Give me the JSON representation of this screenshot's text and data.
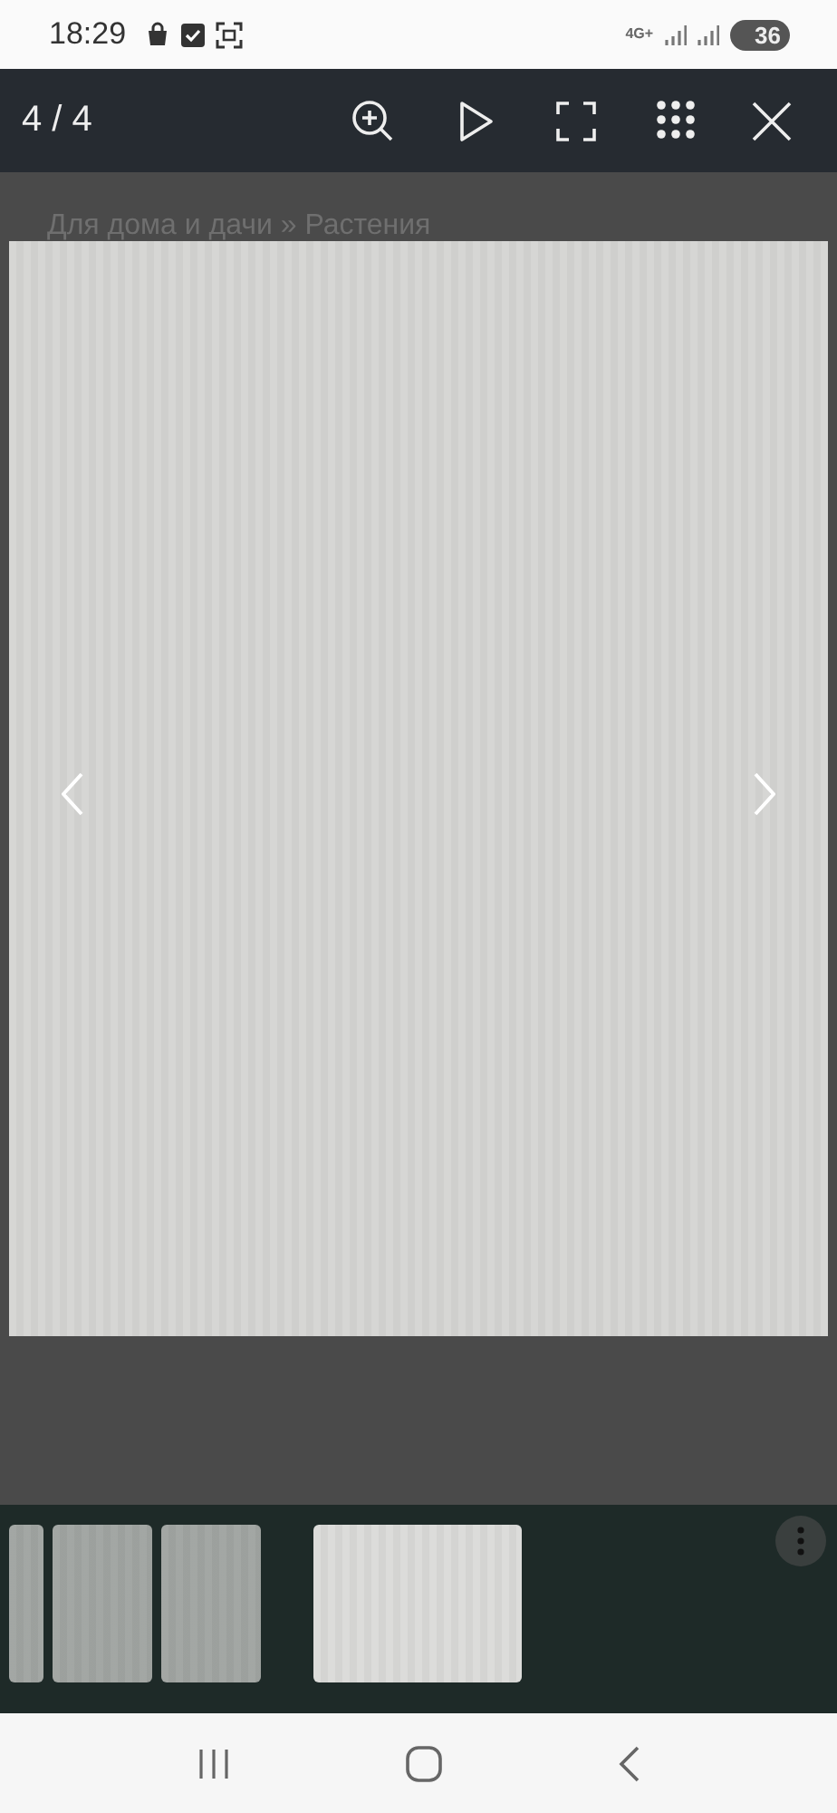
{
  "status_bar": {
    "time": "18:29",
    "network": "4G+",
    "battery": "36"
  },
  "toolbar": {
    "counter": "4 / 4"
  },
  "background_page": {
    "breadcrumb": "Для дома и дачи » Растения"
  },
  "thumbnails": [
    {
      "selected": false,
      "kind": "clipped"
    },
    {
      "selected": false,
      "kind": "full"
    },
    {
      "selected": false,
      "kind": "full"
    },
    {
      "selected": true,
      "kind": "full"
    }
  ]
}
